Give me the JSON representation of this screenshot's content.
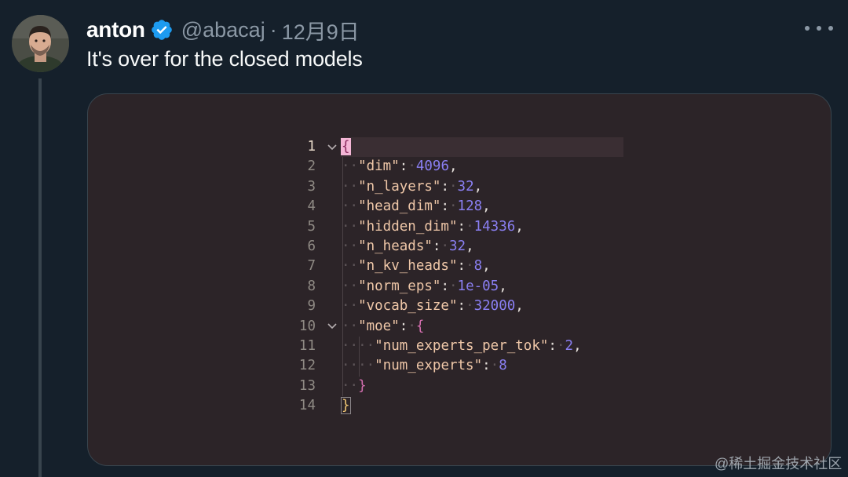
{
  "tweet": {
    "display_name": "anton",
    "handle": "@abacaj",
    "separator": "·",
    "timestamp": "12月9日",
    "text": "It's over for the closed models",
    "verified": true,
    "verified_color": "#1d9bf0",
    "avatar_icon": "user-avatar",
    "more_icon": "more-horizontal-icon"
  },
  "editor": {
    "lines": [
      {
        "n": "1",
        "indent": 0,
        "fold": true,
        "parts": [
          [
            "brace-outer match-cursor",
            "{"
          ]
        ]
      },
      {
        "n": "2",
        "indent": 1,
        "fold": false,
        "parts": [
          [
            "key",
            "\"dim\""
          ],
          [
            "punc",
            ":"
          ],
          [
            "ws",
            "·"
          ],
          [
            "num",
            "4096"
          ],
          [
            "punc",
            ","
          ]
        ]
      },
      {
        "n": "3",
        "indent": 1,
        "fold": false,
        "parts": [
          [
            "key",
            "\"n_layers\""
          ],
          [
            "punc",
            ":"
          ],
          [
            "ws",
            "·"
          ],
          [
            "num",
            "32"
          ],
          [
            "punc",
            ","
          ]
        ]
      },
      {
        "n": "4",
        "indent": 1,
        "fold": false,
        "parts": [
          [
            "key",
            "\"head_dim\""
          ],
          [
            "punc",
            ":"
          ],
          [
            "ws",
            "·"
          ],
          [
            "num",
            "128"
          ],
          [
            "punc",
            ","
          ]
        ]
      },
      {
        "n": "5",
        "indent": 1,
        "fold": false,
        "parts": [
          [
            "key",
            "\"hidden_dim\""
          ],
          [
            "punc",
            ":"
          ],
          [
            "ws",
            "·"
          ],
          [
            "num",
            "14336"
          ],
          [
            "punc",
            ","
          ]
        ]
      },
      {
        "n": "6",
        "indent": 1,
        "fold": false,
        "parts": [
          [
            "key",
            "\"n_heads\""
          ],
          [
            "punc",
            ":"
          ],
          [
            "ws",
            "·"
          ],
          [
            "num",
            "32"
          ],
          [
            "punc",
            ","
          ]
        ]
      },
      {
        "n": "7",
        "indent": 1,
        "fold": false,
        "parts": [
          [
            "key",
            "\"n_kv_heads\""
          ],
          [
            "punc",
            ":"
          ],
          [
            "ws",
            "·"
          ],
          [
            "num",
            "8"
          ],
          [
            "punc",
            ","
          ]
        ]
      },
      {
        "n": "8",
        "indent": 1,
        "fold": false,
        "parts": [
          [
            "key",
            "\"norm_eps\""
          ],
          [
            "punc",
            ":"
          ],
          [
            "ws",
            "·"
          ],
          [
            "num",
            "1e-05"
          ],
          [
            "punc",
            ","
          ]
        ]
      },
      {
        "n": "9",
        "indent": 1,
        "fold": false,
        "parts": [
          [
            "key",
            "\"vocab_size\""
          ],
          [
            "punc",
            ":"
          ],
          [
            "ws",
            "·"
          ],
          [
            "num",
            "32000"
          ],
          [
            "punc",
            ","
          ]
        ]
      },
      {
        "n": "10",
        "indent": 1,
        "fold": true,
        "parts": [
          [
            "key",
            "\"moe\""
          ],
          [
            "punc",
            ":"
          ],
          [
            "ws",
            "·"
          ],
          [
            "brace-inner",
            "{"
          ]
        ]
      },
      {
        "n": "11",
        "indent": 2,
        "fold": false,
        "parts": [
          [
            "key",
            "\"num_experts_per_tok\""
          ],
          [
            "punc",
            ":"
          ],
          [
            "ws",
            "·"
          ],
          [
            "num",
            "2"
          ],
          [
            "punc",
            ","
          ]
        ]
      },
      {
        "n": "12",
        "indent": 2,
        "fold": false,
        "parts": [
          [
            "key",
            "\"num_experts\""
          ],
          [
            "punc",
            ":"
          ],
          [
            "ws",
            "·"
          ],
          [
            "num",
            "8"
          ]
        ]
      },
      {
        "n": "13",
        "indent": 1,
        "fold": false,
        "parts": [
          [
            "brace-inner",
            "}"
          ]
        ]
      },
      {
        "n": "14",
        "indent": 0,
        "fold": false,
        "parts": [
          [
            "brace-outer match-box",
            "}"
          ]
        ]
      }
    ]
  },
  "watermark": "@稀土掘金技术社区"
}
